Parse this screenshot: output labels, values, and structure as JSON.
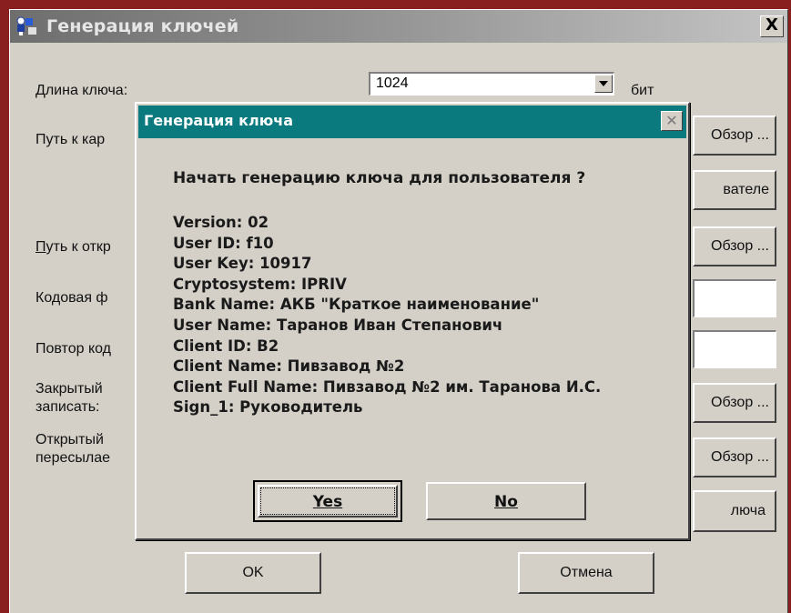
{
  "window": {
    "title": "Генерация ключей",
    "close_label": "X"
  },
  "form": {
    "key_length_label": "Длина ключа:",
    "key_length_value": "1024",
    "key_length_unit": "бит",
    "card_path_label": "Путь к кар",
    "public_path_label": "Путь к откр",
    "codeword_label": "Кодовая ф",
    "repeat_label": "Повтор код",
    "private_label_line1": "Закрытый",
    "private_label_line2": "записать:",
    "public_label_line1": "Открытый",
    "public_label_line2": "пересылае",
    "browse_label": "Обзор ...",
    "browse_label_partial": "Обзор ...",
    "user_btn_label": "вателе",
    "keygen_btn_label": "люча",
    "ok_label": "OK",
    "cancel_label": "Отмена"
  },
  "dialog": {
    "title": "Генерация ключа",
    "close_label": "✕",
    "question": "Начать генерацию ключа для пользователя ?",
    "info_lines": [
      "Version: 02",
      "User ID: f10",
      "User Key: 10917",
      "Cryptosystem: IPRIV",
      "Bank Name: АКБ \"Краткое наименование\"",
      "User Name: Таранов Иван Степанович",
      "Client ID: B2",
      "Client Name: Пивзавод №2",
      "Client Full Name: Пивзавод №2 им. Таранова И.С.",
      "Sign_1: Руководитель"
    ],
    "yes_label": "Yes",
    "no_label": "No"
  },
  "colors": {
    "desktop": "#8a1f1f",
    "dialog_titlebar": "#0a7a7f",
    "window_face": "#d4d0c8"
  },
  "icons": {
    "app": "key-generation-app-icon",
    "dropdown": "chevron-down-icon"
  }
}
